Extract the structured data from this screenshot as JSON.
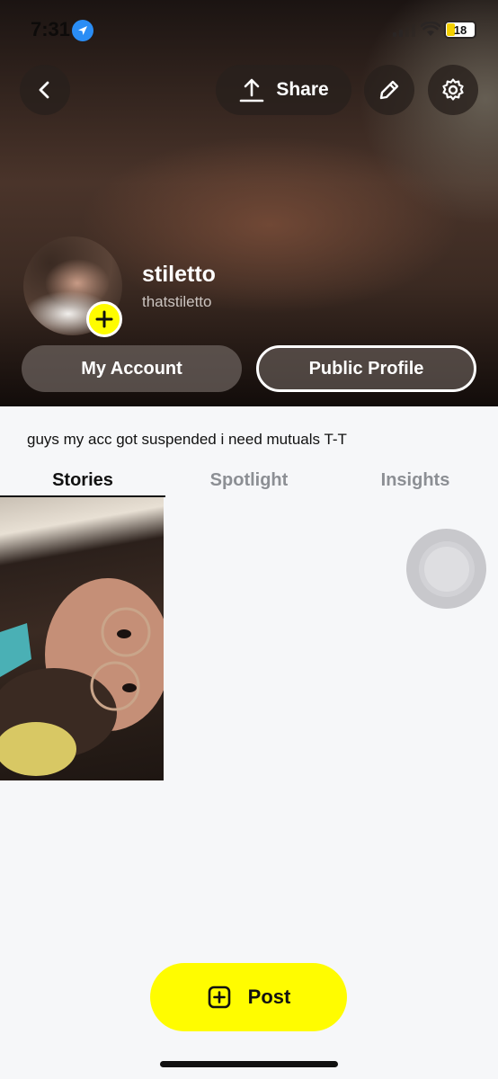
{
  "status_bar": {
    "time": "7:31",
    "battery": "18"
  },
  "header": {
    "back_icon": "chevron-left-icon",
    "share_label": "Share",
    "edit_icon": "pencil-icon",
    "settings_icon": "gear-icon"
  },
  "profile": {
    "display_name": "stiletto",
    "username": "thatstiletto",
    "my_account_label": "My Account",
    "public_profile_label": "Public Profile",
    "bio": "guys my acc got suspended i need mutuals T-T"
  },
  "tabs": [
    {
      "label": "Stories",
      "active": true
    },
    {
      "label": "Spotlight",
      "active": false
    },
    {
      "label": "Insights",
      "active": false
    }
  ],
  "post": {
    "label": "Post"
  },
  "colors": {
    "snap_yellow": "#fffc00",
    "location_blue": "#2a8df5"
  }
}
